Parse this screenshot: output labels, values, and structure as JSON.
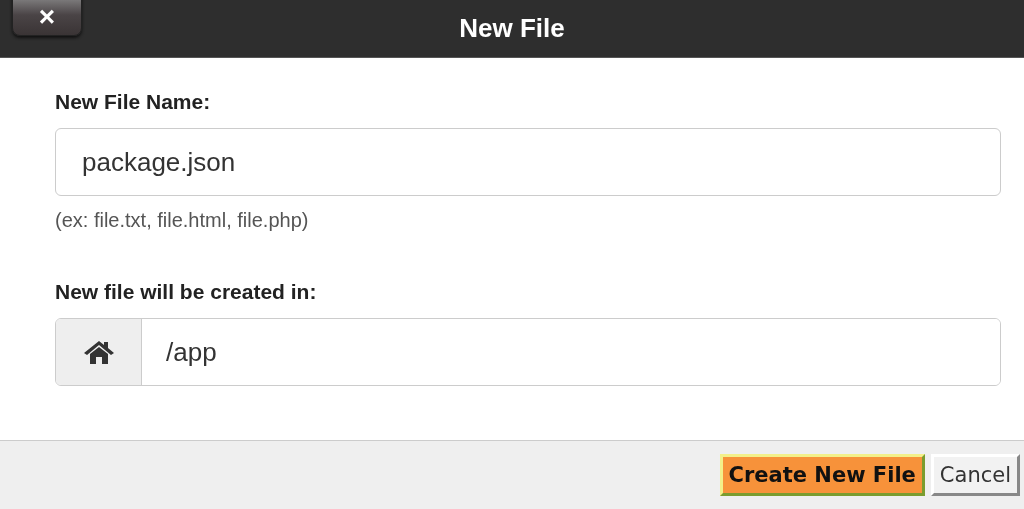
{
  "window": {
    "title": "New File",
    "close": "×"
  },
  "file_name": {
    "label": "New File Name:",
    "value": "package.json",
    "hint": "(ex: file.txt, file.html, file.php)"
  },
  "location": {
    "label": "New file will be created in:",
    "value": "/app"
  },
  "buttons": [
    {
      "label": "Create New File",
      "kind": "primary"
    },
    {
      "label": "Cancel",
      "kind": "secondary"
    }
  ]
}
